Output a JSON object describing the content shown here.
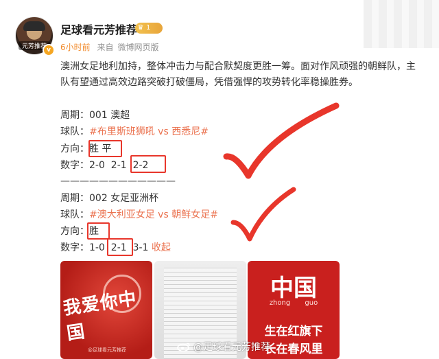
{
  "post": {
    "author": "足球看元芳推荐",
    "level": "1",
    "avatar_caption": "元芳推荐",
    "time": "6小时前",
    "source_prefix": "来自",
    "source": "微博网页版",
    "body": "澳洲女足地利加持，整体冲击力与配合默契度更胜一筹。面对作风顽强的朝鲜队，主队有望通过高效边路突破打破僵局，凭借强悍的攻势转化率稳操胜券。"
  },
  "picks": [
    {
      "period_label": "周期：",
      "period": "001 澳超",
      "team_label": "球队：",
      "team": "#布里斯班狮吼 vs 西悉尼#",
      "dir_label": "方向：",
      "dir_a": "胜",
      "dir_b": "平",
      "num_label": "数字：",
      "n1": "2-0",
      "n2": "2-1",
      "n3": "2-2"
    },
    {
      "period_label": "周期：",
      "period": "002 女足亚洲杯",
      "team_label": "球队：",
      "team": "#澳大利亚女足 vs 朝鲜女足#",
      "dir_label": "方向：",
      "dir_a": "胜",
      "num_label": "数字：",
      "n1": "1-0",
      "n2": "2-1",
      "n3": "3-1",
      "collapse": "收起"
    }
  ],
  "divider": "————————————",
  "images": {
    "img1_text": "我爱你中国",
    "img1_footer": "@足球看元芳推荐",
    "img3_title": "中国",
    "img3_pinyin": "zhong guo",
    "img3_line1": "生在红旗下",
    "img3_line2": "长在春风里"
  },
  "watermark": "@足球看元芳推荐",
  "colors": {
    "accent": "#eb7350",
    "mark": "#e8362b",
    "time": "#f28b2c"
  }
}
